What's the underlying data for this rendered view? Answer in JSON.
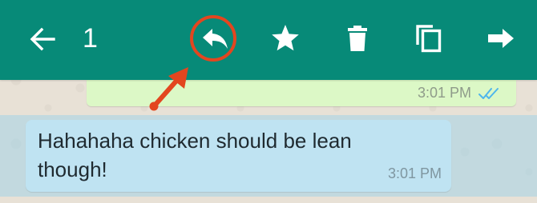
{
  "toolbar": {
    "selection_count": "1",
    "background_color": "#078a78",
    "icons": [
      "back-arrow-icon",
      "reply-icon",
      "star-icon",
      "delete-icon",
      "copy-icon",
      "forward-icon"
    ]
  },
  "annotation": {
    "color": "#e3461f",
    "highlighted_icon": "reply-icon"
  },
  "messages": [
    {
      "direction": "outgoing",
      "time": "3:01 PM",
      "status": "double-check-read",
      "bubble_color": "#dcf8c6"
    },
    {
      "direction": "incoming",
      "text_line_1": "Hahahaha chicken should be lean",
      "text_line_2": "though!",
      "time": "3:01 PM",
      "bubble_color": "#bfe3f2",
      "selected": true
    }
  ]
}
